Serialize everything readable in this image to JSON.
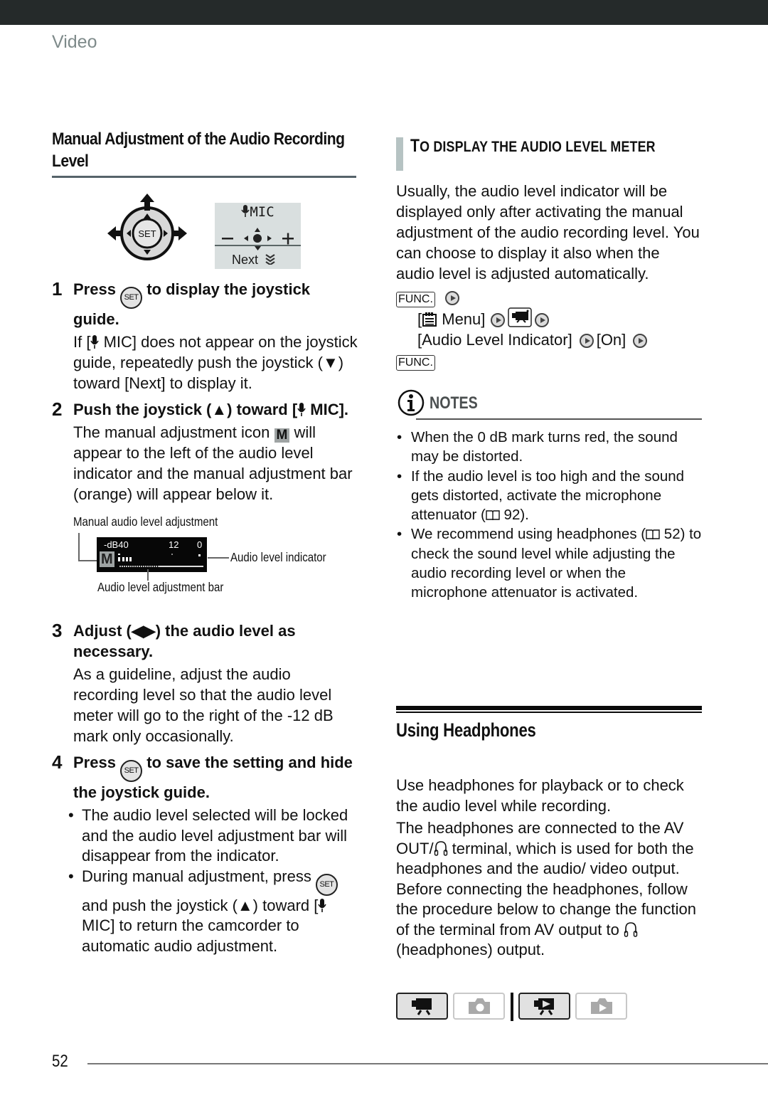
{
  "header": {
    "section": "Video"
  },
  "left": {
    "title": "Manual Adjustment of the Audio Recording Level",
    "joystick": {
      "set_label": "SET"
    },
    "osd": {
      "mic_label": "MIC",
      "minus": "−",
      "plus": "+",
      "next_label": "Next"
    },
    "steps": [
      {
        "num": "1",
        "title_pre": "Press",
        "title_post": "to display the joystick guide.",
        "body_pre": "If [",
        "body_post": " MIC] does not appear on the joystick guide, repeatedly push the joystick (▼) toward [Next] to display it."
      },
      {
        "num": "2",
        "title_pre": "Push the joystick (▲) toward [",
        "title_post": " MIC].",
        "body_pre": "The manual adjustment icon ",
        "m_icon": "M",
        "body_post": " will appear to the left of the audio level indicator and the manual adjustment bar (orange) will appear below it."
      },
      {
        "num": "3",
        "title": "Adjust (◀▶) the audio level as necessary.",
        "body": "As a guideline, adjust the audio recording level so that the audio level meter will go to the right of the -12 dB mark only occasionally."
      },
      {
        "num": "4",
        "title_pre": "Press",
        "title_post": "to save the setting and hide the joystick guide.",
        "bullets": [
          {
            "text": "The audio level selected will be locked and the audio level adjustment bar will disappear from the indicator."
          },
          {
            "pre": "",
            "mid": " and push the joystick (▲) toward [",
            "post": " MIC] to return the camcorder to automatic audio adjustment.",
            "lead": "During manual adjustment, press"
          }
        ]
      }
    ],
    "diagram": {
      "label_manual": "Manual audio level adjustment",
      "label_indicator": "Audio level indicator",
      "label_bar": "Audio level adjustment bar",
      "meter": {
        "db_label": "-dB",
        "tick_40": "40",
        "tick_12": "12",
        "tick_0": "0",
        "m_icon": "M"
      }
    }
  },
  "right": {
    "subheading_first": "T",
    "subheading_rest": "O DISPLAY THE AUDIO LEVEL METER",
    "intro": "Usually, the audio level indicator will be displayed only after activating the manual adjustment of the audio recording level. You can choose to display it also when the audio level is adjusted automatically.",
    "procedure": {
      "func": "FUNC.",
      "menu": " Menu]",
      "menu_open": "[",
      "item": "[Audio Level Indicator]",
      "value": "[On]"
    },
    "notes": {
      "title": "NOTES",
      "items": [
        {
          "text": "When the 0 dB mark turns red, the sound may be distorted."
        },
        {
          "pre": "If the audio level is too high and the sound gets distorted, activate the microphone attenuator (",
          "ref": " 92)."
        },
        {
          "pre": "We recommend using headphones (",
          "ref": " 52) to check the sound level while adjusting the audio recording level or when the microphone attenuator is activated."
        }
      ]
    }
  },
  "headphones": {
    "title": "Using Headphones",
    "p1": "Use headphones for playback or to check the audio level while recording.",
    "p2_a": "The headphones are connected to the AV OUT/",
    "p2_b": " terminal, which is used for both the headphones and the audio/ video output. Before connecting the headphones, follow the procedure below to change the function of the terminal from AV output to ",
    "p2_c": " (headphones) output."
  },
  "modes": [
    {
      "name": "movie-record",
      "active": true
    },
    {
      "name": "photo-record",
      "active": false
    },
    {
      "name": "movie-playback",
      "active": true
    },
    {
      "name": "photo-playback",
      "active": false
    }
  ],
  "footer": {
    "page_number": "52"
  }
}
